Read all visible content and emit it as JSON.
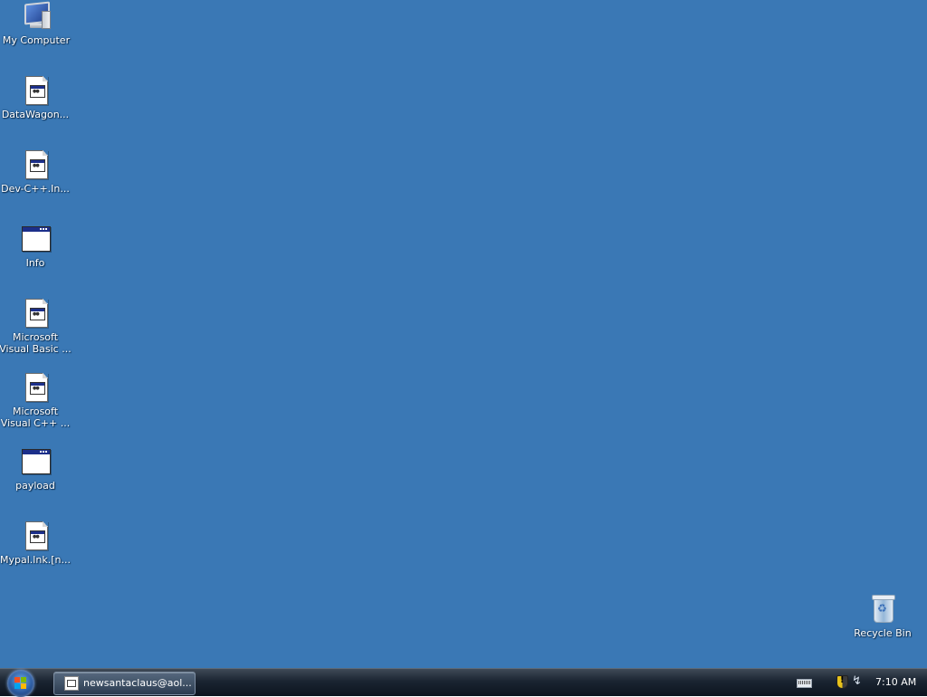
{
  "desktop": {
    "background_color": "#3a78b5",
    "icons": [
      {
        "label": "My Computer",
        "icon": "my-computer-icon"
      },
      {
        "label": "DataWagon...",
        "icon": "file-shortcut-icon"
      },
      {
        "label": "Dev-C++.In...",
        "icon": "file-shortcut-icon"
      },
      {
        "label": "Info",
        "icon": "program-window-icon"
      },
      {
        "label": "Microsoft\nVisual Basic ...",
        "icon": "file-shortcut-icon"
      },
      {
        "label": "Microsoft\nVisual C++ ...",
        "icon": "file-shortcut-icon"
      },
      {
        "label": "payload",
        "icon": "program-window-icon"
      },
      {
        "label": "Mypal.lnk.[n...",
        "icon": "file-shortcut-icon"
      }
    ],
    "recycle_bin": {
      "label": "Recycle Bin",
      "icon": "recycle-bin-icon"
    }
  },
  "taskbar": {
    "start_button": {
      "icon": "windows-start-icon"
    },
    "tasks": [
      {
        "label": "newsantaclaus@aol...",
        "icon": "email-client-icon"
      }
    ],
    "tray": {
      "icons": [
        "keyboard-icon",
        "security-shield-icon",
        "network-icon"
      ],
      "clock": "7:10 AM"
    }
  }
}
